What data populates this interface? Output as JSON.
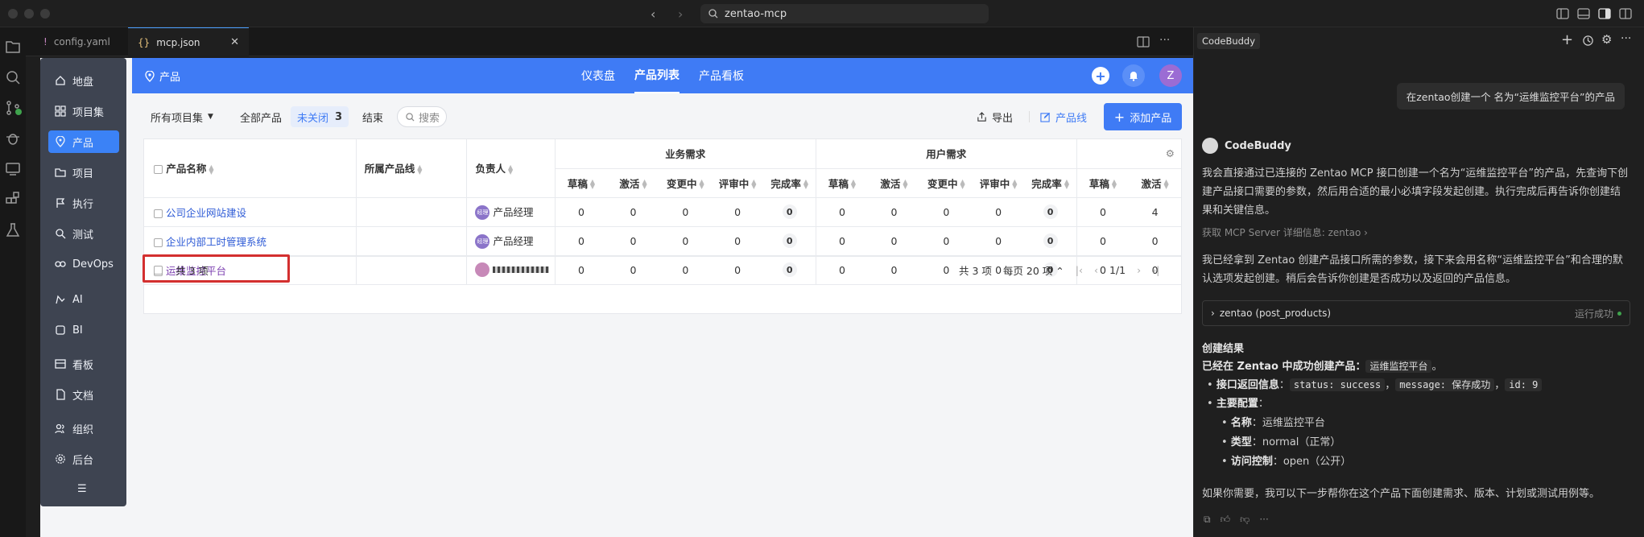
{
  "titlebar": {
    "search": "zentao-mcp"
  },
  "editor": {
    "tabs": [
      {
        "icon": "!",
        "label": "config.yaml"
      },
      {
        "icon": "{}",
        "label": "mcp.json"
      }
    ]
  },
  "sidebar": {
    "items": [
      {
        "label": "地盘",
        "icon": "home-icon"
      },
      {
        "label": "项目集",
        "icon": "grid-icon"
      },
      {
        "label": "产品",
        "icon": "location-icon",
        "active": true
      },
      {
        "label": "项目",
        "icon": "folder-icon"
      },
      {
        "label": "执行",
        "icon": "flag-icon"
      },
      {
        "label": "测试",
        "icon": "search-icon"
      },
      {
        "label": "DevOps",
        "icon": "devops-icon"
      },
      {
        "label": "AI",
        "icon": "ai-icon"
      },
      {
        "label": "BI",
        "icon": "bi-icon"
      },
      {
        "label": "看板",
        "icon": "board-icon"
      },
      {
        "label": "文档",
        "icon": "doc-icon"
      },
      {
        "label": "组织",
        "icon": "group-icon"
      },
      {
        "label": "后台",
        "icon": "gear-icon"
      }
    ]
  },
  "topnav": {
    "section": "产品",
    "links": [
      "仪表盘",
      "产品列表",
      "产品看板"
    ],
    "user_initial": "Z"
  },
  "filters": {
    "program": "所有项目集",
    "all": "全部产品",
    "open": "未关闭",
    "open_count": "3",
    "closed": "结束",
    "search_placeholder": "搜索"
  },
  "actions": {
    "export": "导出",
    "product_line": "产品线",
    "add_product": "添加产品"
  },
  "table": {
    "col_name": "产品名称",
    "col_line": "所属产品线",
    "col_owner": "负责人",
    "group_business": "业务需求",
    "group_user": "用户需求",
    "sub_cols": [
      "草稿",
      "激活",
      "变更中",
      "评审中",
      "完成率"
    ],
    "sub_cols_last": [
      "草稿",
      "激活"
    ],
    "rows": [
      {
        "name": "公司企业网站建设",
        "owner_badge": "经理",
        "owner": "产品经理",
        "biz": [
          "0",
          "0",
          "0",
          "0",
          "0"
        ],
        "usr": [
          "0",
          "0",
          "0",
          "0",
          "0"
        ],
        "extra": [
          "0",
          "4"
        ]
      },
      {
        "name": "企业内部工时管理系统",
        "owner_badge": "经理",
        "owner": "产品经理",
        "biz": [
          "0",
          "0",
          "0",
          "0",
          "0"
        ],
        "usr": [
          "0",
          "0",
          "0",
          "0",
          "0"
        ],
        "extra": [
          "0",
          "0"
        ]
      },
      {
        "name": "运维监控平台",
        "owner_badge": "",
        "owner": "",
        "biz": [
          "0",
          "0",
          "0",
          "0",
          "0"
        ],
        "usr": [
          "0",
          "0",
          "0",
          "0",
          "0"
        ],
        "extra": [
          "0",
          "0"
        ]
      }
    ],
    "footer_total": "共 3 项",
    "pager_total": "共 3 项",
    "page_size": "每页 20 项",
    "page": "1/1"
  },
  "chat": {
    "title": "CodeBuddy",
    "user_msg": "在zentao创建一个 名为“运维监控平台”的产品",
    "bot_name": "CodeBuddy",
    "p1": "我会直接通过已连接的 Zentao MCP 接口创建一个名为“运维监控平台”的产品，先查询下创建产品接口需要的参数，然后用合适的最小必填字段发起创建。执行完成后再告诉你创建结果和关键信息。",
    "mcp_link": "获取 MCP Server 详细信息: zentao",
    "p2": "我已经拿到 Zentao 创建产品接口所需的参数，接下来会用名称“运维监控平台”和合理的默认选项发起创建。稍后会告诉你创建是否成功以及返回的产品信息。",
    "tool_name": "zentao (post_products)",
    "tool_status": "运行成功",
    "result_title": "创建结果",
    "result_line_prefix": "已经在 Zentao 中成功创建产品：",
    "result_product": "运维监控平台",
    "result_line_suffix": "。",
    "api_label": "接口返回信息",
    "api_status": "status: success",
    "api_message": "message: 保存成功",
    "api_id": "id: 9",
    "config_label": "主要配置",
    "cfg_name_label": "名称",
    "cfg_name": "运维监控平台",
    "cfg_type_label": "类型",
    "cfg_type": "normal（正常）",
    "cfg_acl_label": "访问控制",
    "cfg_acl": "open（公开）",
    "closing": "如果你需要，我可以下一步帮你在这个产品下面创建需求、版本、计划或测试用例等。"
  },
  "colors": {
    "accent": "#3f7bf5",
    "sidebar": "#3e4451",
    "highlight": "#d32f2f"
  }
}
